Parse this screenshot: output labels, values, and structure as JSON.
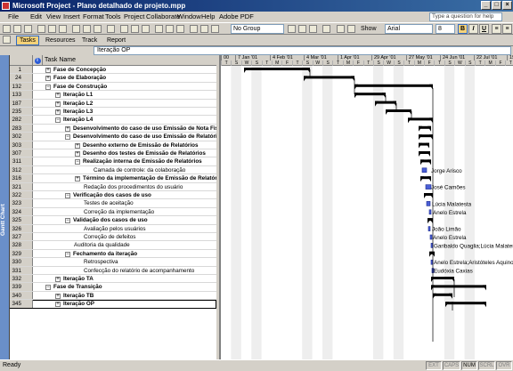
{
  "title": "Microsoft Project - Plano detalhado de projeto.mpp",
  "menu": [
    "File",
    "Edit",
    "View",
    "Insert",
    "Format",
    "Tools",
    "Project",
    "Collaborate",
    "Window",
    "Help",
    "Adobe PDF"
  ],
  "help_placeholder": "Type a question for help",
  "toolbar": {
    "group": "No Group",
    "show": "Show",
    "font": "Arial",
    "size": "8",
    "bold": "B",
    "italic": "I",
    "underline": "U"
  },
  "toolbar2": [
    "Tasks",
    "Resources",
    "Track",
    "Report"
  ],
  "entry": "Iteração OP",
  "side_label": "Gantt Chart",
  "table": {
    "col_info": "i",
    "col_name": "Task Name"
  },
  "timeline": {
    "weeks": [
      "00",
      "7 Jan '01",
      "4 Feb '01",
      "4 Mar '01",
      "1 Apr '01",
      "29 Apr '01",
      "27 May '01",
      "24 Jun '01",
      "22 Jul '01",
      "19"
    ],
    "days": [
      "T",
      "S",
      "W",
      "S",
      "T",
      "M",
      "F",
      "T",
      "S",
      "W",
      "S",
      "T",
      "M",
      "F",
      "T",
      "S",
      "W",
      "S",
      "T",
      "M",
      "F",
      "T",
      "S",
      "W",
      "S",
      "T",
      "M",
      "F",
      "T"
    ]
  },
  "tasks": [
    {
      "id": "1",
      "name": "Fase de Concepção",
      "level": 0,
      "summary": true,
      "toggle": "+"
    },
    {
      "id": "24",
      "name": "Fase de Elaboração",
      "level": 0,
      "summary": true,
      "toggle": "+"
    },
    {
      "id": "132",
      "name": "Fase de Construção",
      "level": 0,
      "summary": true,
      "toggle": "−"
    },
    {
      "id": "133",
      "name": "Iteração L1",
      "level": 1,
      "summary": true,
      "toggle": "+"
    },
    {
      "id": "187",
      "name": "Iteração L2",
      "level": 1,
      "summary": true,
      "toggle": "+"
    },
    {
      "id": "235",
      "name": "Iteração L3",
      "level": 1,
      "summary": true,
      "toggle": "+"
    },
    {
      "id": "282",
      "name": "Iteração L4",
      "level": 1,
      "summary": true,
      "toggle": "−"
    },
    {
      "id": "283",
      "name": "Desenvolvimento do caso de uso Emissão de Nota Fiscal",
      "level": 2,
      "summary": true,
      "toggle": "+"
    },
    {
      "id": "302",
      "name": "Desenvolvimento do caso de uso Emissão de Relatórios",
      "level": 2,
      "summary": true,
      "toggle": "−"
    },
    {
      "id": "303",
      "name": "Desenho externo de Emissão de Relatórios",
      "level": 3,
      "summary": true,
      "toggle": "+"
    },
    {
      "id": "307",
      "name": "Desenho dos testes de Emissão de Relatórios",
      "level": 3,
      "summary": true,
      "toggle": "+"
    },
    {
      "id": "311",
      "name": "Realização interna de Emissão de Relatórios",
      "level": 3,
      "summary": true,
      "toggle": "−"
    },
    {
      "id": "312",
      "name": "Camada de controle: da colaboração",
      "level": 4,
      "summary": false,
      "toggle": ""
    },
    {
      "id": "316",
      "name": "Término da implementação de Emissão de Relatórios",
      "level": 3,
      "summary": true,
      "toggle": "+"
    },
    {
      "id": "321",
      "name": "Redação dos procedimentos do usuário",
      "level": 3,
      "summary": false,
      "toggle": ""
    },
    {
      "id": "322",
      "name": "Verificação dos casos de uso",
      "level": 2,
      "summary": true,
      "toggle": "−"
    },
    {
      "id": "323",
      "name": "Testes de aceitação",
      "level": 3,
      "summary": false,
      "toggle": ""
    },
    {
      "id": "324",
      "name": "Correção da implementação",
      "level": 3,
      "summary": false,
      "toggle": ""
    },
    {
      "id": "325",
      "name": "Validação dos casos de uso",
      "level": 2,
      "summary": true,
      "toggle": "−"
    },
    {
      "id": "326",
      "name": "Avaliação pelos usuários",
      "level": 3,
      "summary": false,
      "toggle": ""
    },
    {
      "id": "327",
      "name": "Correção de defeitos",
      "level": 3,
      "summary": false,
      "toggle": ""
    },
    {
      "id": "328",
      "name": "Auditoria da qualidade",
      "level": 2,
      "summary": false,
      "toggle": ""
    },
    {
      "id": "329",
      "name": "Fechamento da iteração",
      "level": 2,
      "summary": true,
      "toggle": "−"
    },
    {
      "id": "330",
      "name": "Retrospectiva",
      "level": 3,
      "summary": false,
      "toggle": ""
    },
    {
      "id": "331",
      "name": "Confecção do relatório de acompanhamento",
      "level": 3,
      "summary": false,
      "toggle": ""
    },
    {
      "id": "332",
      "name": "Iteração TA",
      "level": 1,
      "summary": true,
      "toggle": "+"
    },
    {
      "id": "339",
      "name": "Fase de Transição",
      "level": 0,
      "summary": true,
      "toggle": "−"
    },
    {
      "id": "340",
      "name": "Iteração TB",
      "level": 1,
      "summary": true,
      "toggle": "+"
    },
    {
      "id": "345",
      "name": "Iteração OP",
      "level": 1,
      "summary": true,
      "toggle": "+"
    }
  ],
  "gantt_labels": [
    "Jorge Arisco",
    "José Camões",
    "Lúcia Malatesta",
    "Anelo Estrela",
    "João Limão",
    "Anelo Estrela",
    "Garibaldo Quaglia;Lúcia Malatesta",
    "Anelo Estrela;Aristóteles Aquino",
    "Eudóxia Caxias"
  ],
  "status": {
    "text": "Ready",
    "indicators": [
      "EXT",
      "CAPS",
      "NUM",
      "SCRL",
      "OVR"
    ]
  }
}
